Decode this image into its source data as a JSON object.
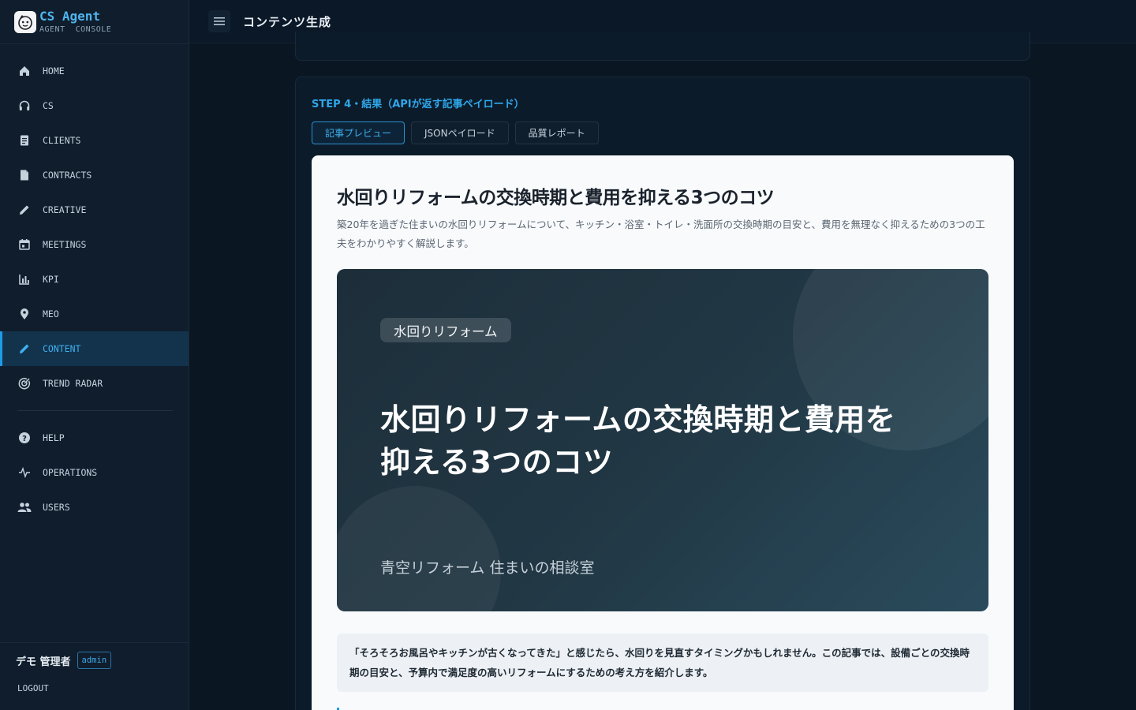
{
  "brand": {
    "title": "CS Agent",
    "subtitle": "AGENT  CONSOLE"
  },
  "sidebar": {
    "items": [
      {
        "label": "HOME",
        "icon": "home-icon"
      },
      {
        "label": "CS",
        "icon": "headset-icon"
      },
      {
        "label": "CLIENTS",
        "icon": "clipboard-icon"
      },
      {
        "label": "CONTRACTS",
        "icon": "document-icon"
      },
      {
        "label": "CREATIVE",
        "icon": "pencil-icon"
      },
      {
        "label": "MEETINGS",
        "icon": "calendar-icon"
      },
      {
        "label": "KPI",
        "icon": "bar-chart-icon"
      },
      {
        "label": "MEO",
        "icon": "map-pin-icon"
      },
      {
        "label": "CONTENT",
        "icon": "pencil-icon",
        "active": true
      },
      {
        "label": "TREND RADAR",
        "icon": "radar-icon"
      }
    ],
    "secondary": [
      {
        "label": "HELP",
        "icon": "help-icon"
      },
      {
        "label": "OPERATIONS",
        "icon": "pulse-icon"
      },
      {
        "label": "USERS",
        "icon": "users-icon"
      }
    ],
    "user": {
      "name": "デモ 管理者",
      "role": "admin"
    },
    "logout": "LOGOUT"
  },
  "header": {
    "title": "コンテンツ生成"
  },
  "step": {
    "title": "STEP 4・結果（APIが返す記事ペイロード）",
    "tabs": [
      "記事プレビュー",
      "JSONペイロード",
      "品質レポート"
    ],
    "active_tab": 0
  },
  "article": {
    "title": "水回りリフォームの交換時期と費用を抑える3つのコツ",
    "description": "築20年を過ぎた住まいの水回りリフォームについて、キッチン・浴室・トイレ・洗面所の交換時期の目安と、費用を無理なく抑えるための3つの工夫をわかりやすく解説します。",
    "hero": {
      "tag": "水回りリフォーム",
      "title": "水回りリフォームの交換時期と費用を抑える3つのコツ",
      "site": "青空リフォーム 住まいの相談室"
    },
    "intro": "「そろそろお風呂やキッチンが古くなってきた」と感じたら、水回りを見直すタイミングかもしれません。この記事では、設備ごとの交換時期の目安と、予算内で満足度の高いリフォームにするための考え方を紹介します。"
  },
  "colors": {
    "accent": "#1e9be6",
    "sidebar_bg": "#0f1d2c",
    "page_bg": "#0a1622"
  }
}
